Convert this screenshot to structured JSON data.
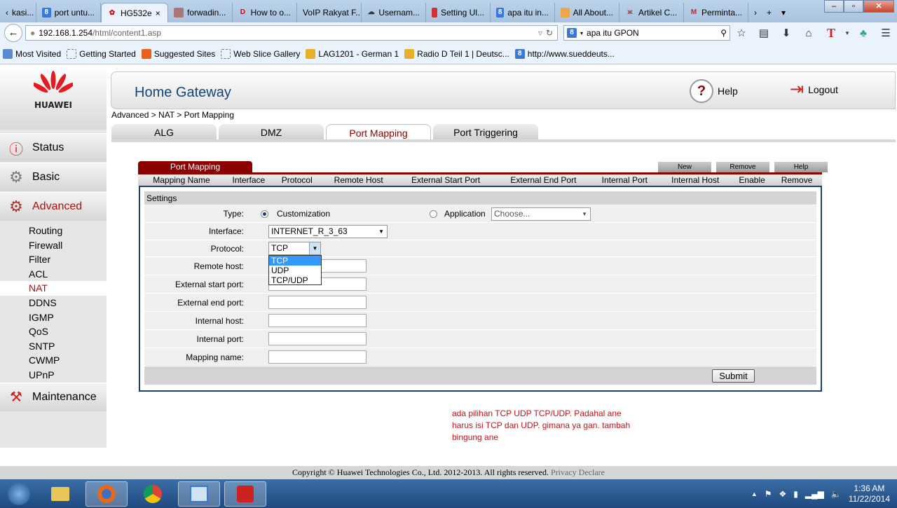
{
  "browser": {
    "tabs": [
      {
        "label": "kasi...",
        "icon": "chevron-left-icon"
      },
      {
        "label": "port untu...",
        "icon": "google-icon"
      },
      {
        "label": "HG532e",
        "icon": "huawei-icon",
        "active": true
      },
      {
        "label": "forwadin...",
        "icon": "avatar-icon"
      },
      {
        "label": "How to o...",
        "icon": "d-icon"
      },
      {
        "label": "VoIP Rakyat F...",
        "icon": ""
      },
      {
        "label": "Usernam...",
        "icon": "cloud-icon"
      },
      {
        "label": "Setting Ul...",
        "icon": "site-icon"
      },
      {
        "label": "apa itu in...",
        "icon": "google-icon"
      },
      {
        "label": "All About...",
        "icon": "site-icon"
      },
      {
        "label": "Artikel C...",
        "icon": "site-icon"
      },
      {
        "label": "Perminta...",
        "icon": "gmail-icon"
      }
    ],
    "close_tab": "×",
    "url_host": "192.168.1.254",
    "url_path": "/html/content1.asp",
    "search_value": "apa itu GPON",
    "bookmarks": [
      "Most Visited",
      "Getting Started",
      "Suggested Sites",
      "Web Slice Gallery",
      "LAG1201 - German 1",
      "Radio D Teil 1 | Deutsc...",
      "http://www.sueddeuts..."
    ]
  },
  "app": {
    "brand": "HUAWEI",
    "title": "Home Gateway",
    "help": "Help",
    "logout": "Logout",
    "breadcrumb": "Advanced > NAT > Port Mapping",
    "menu": {
      "status": "Status",
      "basic": "Basic",
      "advanced": "Advanced",
      "maintenance": "Maintenance"
    },
    "submenu": [
      "Routing",
      "Firewall",
      "Filter",
      "ACL",
      "NAT",
      "DDNS",
      "IGMP",
      "QoS",
      "SNTP",
      "CWMP",
      "UPnP"
    ],
    "nat_tabs": [
      "ALG",
      "DMZ",
      "Port Mapping",
      "Port Triggering"
    ],
    "section_title": "Port Mapping",
    "actions": [
      "New",
      "Remove",
      "Help"
    ],
    "columns": [
      "Mapping Name",
      "Interface",
      "Protocol",
      "Remote Host",
      "External Start Port",
      "External End Port",
      "Internal Port",
      "Internal Host",
      "Enable",
      "Remove"
    ],
    "settings": {
      "header": "Settings",
      "type_label": "Type:",
      "type_customization": "Customization",
      "type_application": "Application",
      "application_placeholder": "Choose...",
      "interface_label": "Interface:",
      "interface_value": "INTERNET_R_3_63",
      "protocol_label": "Protocol:",
      "protocol_value": "TCP",
      "protocol_options": [
        "TCP",
        "UDP",
        "TCP/UDP"
      ],
      "remote_host_label": "Remote host:",
      "ext_start_label": "External start port:",
      "ext_end_label": "External end port:",
      "internal_host_label": "Internal host:",
      "internal_port_label": "Internal port:",
      "mapping_name_label": "Mapping name:",
      "submit": "Submit"
    },
    "copyright": "Copyright © Huawei Technologies Co., Ltd. 2012-2013. All rights reserved.",
    "privacy": "Privacy Declare",
    "accent": "#8b0000"
  },
  "note": "ada pilihan TCP UDP TCP/UDP. Padahal ane harus isi TCP dan UDP. gimana ya gan. tambah bingung ane",
  "taskbar": {
    "time": "1:36 AM",
    "date": "11/22/2014"
  }
}
